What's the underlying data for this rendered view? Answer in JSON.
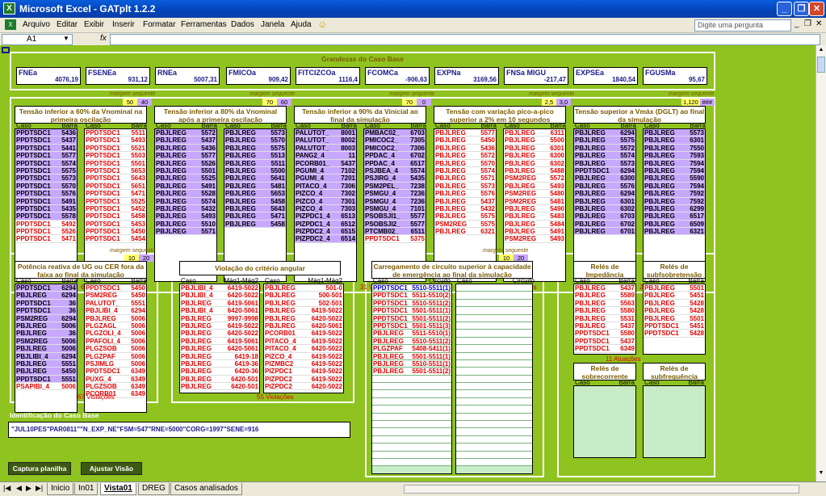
{
  "window": {
    "title": "Microsoft Excel - GATplt 1.2.2"
  },
  "menu": {
    "items": [
      "Arquivo",
      "Editar",
      "Exibir",
      "Inserir",
      "Formatar",
      "Ferramentas",
      "Dados",
      "Janela",
      "Ajuda"
    ],
    "ask_placeholder": "Digite uma pergunta"
  },
  "formula": {
    "namebox": "A1",
    "fx": "fx"
  },
  "grandezas": {
    "title": "Grandezas do Caso Base",
    "items": [
      {
        "label": "FNEa",
        "value": "4076,19"
      },
      {
        "label": "FSENEa",
        "value": "931,12"
      },
      {
        "label": "RNEa",
        "value": "5007,31"
      },
      {
        "label": "FMICOa",
        "value": "909,42"
      },
      {
        "label": "FITCIZCOa",
        "value": "1116,4"
      },
      {
        "label": "FCOMCa",
        "value": "-906,63"
      },
      {
        "label": "EXPNa",
        "value": "3169,56"
      },
      {
        "label": "FNSa MIGU",
        "value": "-217,47"
      },
      {
        "label": "EXPSEa",
        "value": "1840,54"
      },
      {
        "label": "FGUSMa",
        "value": "95,67"
      }
    ]
  },
  "margin_label": "margem sequente",
  "tables_top": [
    {
      "title": "Tensão inferior a 60% da Vnominal na primeira oscilação",
      "n1": "50",
      "n2": "40",
      "viol": "69 Violações",
      "left": [
        [
          "PPDTSDC1",
          "5436",
          "p"
        ],
        [
          "PPDTSDC1",
          "5437",
          "p"
        ],
        [
          "PPDTSDC1",
          "5441",
          "p"
        ],
        [
          "PPDTSDC1",
          "5577",
          "p"
        ],
        [
          "PPDTSDC1",
          "5574",
          "p"
        ],
        [
          "PPDTSDC1",
          "5575",
          "p"
        ],
        [
          "PPDTSDC1",
          "5573",
          "p"
        ],
        [
          "PPDTSDC1",
          "5570",
          "p"
        ],
        [
          "PPDTSDC1",
          "5576",
          "p"
        ],
        [
          "PPDTSDC1",
          "5491",
          "p"
        ],
        [
          "PPDTSDC1",
          "5435",
          "p"
        ],
        [
          "PPDTSDC1",
          "5578",
          "p"
        ],
        [
          "PPDTSDC1",
          "5492",
          "r"
        ],
        [
          "PPDTSDC1",
          "5526",
          "r"
        ],
        [
          "PPDTSDC1",
          "5471",
          "r"
        ]
      ],
      "right": [
        [
          "PPDTSDC1",
          "5511",
          "r"
        ],
        [
          "PPDTSDC1",
          "5493",
          "r"
        ],
        [
          "PPDTSDC1",
          "5521",
          "r"
        ],
        [
          "PPDTSDC1",
          "5503",
          "r"
        ],
        [
          "PPDTSDC1",
          "5501",
          "r"
        ],
        [
          "PPDTSDC1",
          "5653",
          "r"
        ],
        [
          "PPDTSDC1",
          "5643",
          "r"
        ],
        [
          "PPDTSDC1",
          "5651",
          "r"
        ],
        [
          "PPDTSDC1",
          "5471",
          "r"
        ],
        [
          "PPDTSDC1",
          "5525",
          "r"
        ],
        [
          "PPDTSDC1",
          "5452",
          "r"
        ],
        [
          "PPDTSDC1",
          "5458",
          "r"
        ],
        [
          "PPDTSDC1",
          "5453",
          "r"
        ],
        [
          "PPDTSDC1",
          "5450",
          "r"
        ],
        [
          "PPDTSDC1",
          "5454",
          "r"
        ]
      ]
    },
    {
      "title": "Tensão inferior a 80% da Vnominal após a primeira oscilação",
      "n1": "70",
      "n2": "60",
      "viol": "129 Violações",
      "left": [
        [
          "PBJLREG",
          "5572",
          "p"
        ],
        [
          "PBJLREG",
          "5437",
          "p"
        ],
        [
          "PBJLREG",
          "5436",
          "p"
        ],
        [
          "PBJLREG",
          "5577",
          "p"
        ],
        [
          "PBJLREG",
          "5526",
          "p"
        ],
        [
          "PBJLREG",
          "5501",
          "p"
        ],
        [
          "PBJLREG",
          "5525",
          "p"
        ],
        [
          "PBJLREG",
          "5491",
          "p"
        ],
        [
          "PBJLREG",
          "5528",
          "p"
        ],
        [
          "PBJLREG",
          "5574",
          "p"
        ],
        [
          "PBJLREG",
          "5432",
          "p"
        ],
        [
          "PBJLREG",
          "5493",
          "p"
        ],
        [
          "PBJLREG",
          "5510",
          "p"
        ],
        [
          "PBJLREG",
          "5571",
          "p"
        ]
      ],
      "right": [
        [
          "PBJLREG",
          "5573",
          "p"
        ],
        [
          "PBJLREG",
          "5570",
          "p"
        ],
        [
          "PBJLREG",
          "5575",
          "p"
        ],
        [
          "PBJLREG",
          "5513",
          "p"
        ],
        [
          "PBJLREG",
          "5511",
          "p"
        ],
        [
          "PBJLREG",
          "5500",
          "p"
        ],
        [
          "PBJLREG",
          "5641",
          "p"
        ],
        [
          "PBJLREG",
          "5481",
          "p"
        ],
        [
          "PBJLREG",
          "5653",
          "p"
        ],
        [
          "PBJLREG",
          "5458",
          "p"
        ],
        [
          "PBJLREG",
          "5643",
          "p"
        ],
        [
          "PBJLREG",
          "5471",
          "p"
        ],
        [
          "PBJLREG",
          "5458",
          "p"
        ]
      ]
    },
    {
      "title": "Tensão inferior a 90% da Vinicial ao final da simulação",
      "n1": "70",
      "n2": "0",
      "viol": "31 Violações",
      "left": [
        [
          "PALUTOT_",
          "8001",
          "p"
        ],
        [
          "PALUTOT_",
          "8002",
          "p"
        ],
        [
          "PALUTOT_",
          "8003",
          "p"
        ],
        [
          "PANG2_4",
          "11",
          "p"
        ],
        [
          "PCORB01_",
          "5437",
          "p"
        ],
        [
          "PGUMI_4",
          "7102",
          "p"
        ],
        [
          "PGUMI_4",
          "7201",
          "p"
        ],
        [
          "PITACO_4",
          "7306",
          "p"
        ],
        [
          "PIZCO_4",
          "7302",
          "p"
        ],
        [
          "PIZCO_4",
          "7301",
          "p"
        ],
        [
          "PIZCO_4",
          "7303",
          "p"
        ],
        [
          "PIZPDC1_4",
          "6513",
          "p"
        ],
        [
          "PIZPDC1_4",
          "6512",
          "p"
        ],
        [
          "PIZPDC2_4",
          "6515",
          "p"
        ],
        [
          "PIZPDC2_4",
          "6514",
          "p"
        ]
      ],
      "right": [
        [
          "PMBAC02_",
          "6703",
          "p"
        ],
        [
          "PMICOC2_",
          "7305",
          "p"
        ],
        [
          "PMICOC2_",
          "7306",
          "p"
        ],
        [
          "PPDAC_4",
          "6702",
          "p"
        ],
        [
          "PPDAC_4",
          "6517",
          "p"
        ],
        [
          "PSJBEA_4",
          "5574",
          "p"
        ],
        [
          "PSJIRG_4",
          "5435",
          "p"
        ],
        [
          "PSM2PEL_",
          "7238",
          "p"
        ],
        [
          "PSMGU_4",
          "7236",
          "p"
        ],
        [
          "PSMGU_4",
          "7236",
          "p"
        ],
        [
          "PSMGU_4",
          "7101",
          "p"
        ],
        [
          "PSOBSJI1_",
          "5577",
          "p"
        ],
        [
          "PSOBSJI2_",
          "5577",
          "p"
        ],
        [
          "PTCMB02_",
          "6511",
          "p"
        ],
        [
          "PPDTSDC1",
          "5375",
          "r"
        ]
      ]
    },
    {
      "title": "Tensão com variação pico-a-pico superior a 2% em 10 segundos",
      "n1": "2,5",
      "n2": "3,0",
      "viol": "53 Violações",
      "left": [
        [
          "PBJLREG",
          "5577",
          "r"
        ],
        [
          "PBJLREG",
          "5450",
          "r"
        ],
        [
          "PBJLREG",
          "5436",
          "r"
        ],
        [
          "PBJLREG",
          "5572",
          "r"
        ],
        [
          "PBJLREG",
          "5570",
          "r"
        ],
        [
          "PBJLREG",
          "5574",
          "r"
        ],
        [
          "PBJLREG",
          "5571",
          "r"
        ],
        [
          "PBJLREG",
          "5573",
          "r"
        ],
        [
          "PBJLREG",
          "5576",
          "r"
        ],
        [
          "PBJLREG",
          "5437",
          "r"
        ],
        [
          "PBJLREG",
          "5432",
          "r"
        ],
        [
          "PBJLREG",
          "5575",
          "r"
        ],
        [
          "PSM2REG",
          "5575",
          "r"
        ],
        [
          "PBJLREG",
          "6321",
          "r"
        ]
      ],
      "right": [
        [
          "PBJLREG",
          "6311",
          "r"
        ],
        [
          "PBJLREG",
          "5500",
          "r"
        ],
        [
          "PBJLREG",
          "6301",
          "r"
        ],
        [
          "PBJLREG",
          "6300",
          "r"
        ],
        [
          "PBJLREG",
          "6302",
          "r"
        ],
        [
          "PBJLREG",
          "5488",
          "r"
        ],
        [
          "PSM2REG",
          "5572",
          "r"
        ],
        [
          "PBJLREG",
          "5493",
          "r"
        ],
        [
          "PSM2REG",
          "5480",
          "r"
        ],
        [
          "PSM2REG",
          "5481",
          "r"
        ],
        [
          "PBJLREG",
          "5490",
          "r"
        ],
        [
          "PBJLREG",
          "5483",
          "r"
        ],
        [
          "PBJLREG",
          "5484",
          "r"
        ],
        [
          "PBJLREG",
          "5491",
          "r"
        ],
        [
          "PSM2REG",
          "5493",
          "r"
        ]
      ]
    },
    {
      "title": "Tensão superior a Vmáx (DGLT) ao final da simulação",
      "n1": "1,120",
      "n2": "###",
      "viol": "200 Violações",
      "left": [
        [
          "PBJLREG",
          "6294",
          "p"
        ],
        [
          "PBJLREG",
          "5575",
          "p"
        ],
        [
          "PBJLREG",
          "5572",
          "p"
        ],
        [
          "PBJLREG",
          "5574",
          "p"
        ],
        [
          "PBJLREG",
          "5573",
          "p"
        ],
        [
          "PPDTSDC1",
          "6294",
          "p"
        ],
        [
          "PBJLREG",
          "6300",
          "p"
        ],
        [
          "PBJLREG",
          "5576",
          "p"
        ],
        [
          "PBJLREG",
          "6294",
          "p"
        ],
        [
          "PBJLREG",
          "6301",
          "p"
        ],
        [
          "PBJLREG",
          "6302",
          "p"
        ],
        [
          "PBJLREG",
          "6703",
          "p"
        ],
        [
          "PBJLREG",
          "6702",
          "p"
        ],
        [
          "PBJLREG",
          "6701",
          "p"
        ]
      ],
      "right": [
        [
          "PBJLREG",
          "5573",
          "p"
        ],
        [
          "PBJLREG",
          "6301",
          "p"
        ],
        [
          "PBJLREG",
          "7550",
          "p"
        ],
        [
          "PBJLREG",
          "7593",
          "p"
        ],
        [
          "PBJLREG",
          "7594",
          "p"
        ],
        [
          "PBJLREG",
          "7594",
          "p"
        ],
        [
          "PBJLREG",
          "5590",
          "p"
        ],
        [
          "PBJLREG",
          "7594",
          "p"
        ],
        [
          "PBJLREG",
          "7592",
          "p"
        ],
        [
          "PBJLREG",
          "7592",
          "p"
        ],
        [
          "PBJLREG",
          "6299",
          "p"
        ],
        [
          "PBJLREG",
          "6517",
          "p"
        ],
        [
          "PBJLREG",
          "6509",
          "p"
        ],
        [
          "PBJLREG",
          "6321",
          "p"
        ]
      ]
    }
  ],
  "pot": {
    "title": "Potência reativa de UG ou CER fora da faixa ao final da simulação",
    "n1": "10",
    "n2": "20",
    "viol": "67 Violações",
    "left": [
      [
        "PPDTSDC1",
        "6294",
        "p"
      ],
      [
        "PBJLREG",
        "6294",
        "p"
      ],
      [
        "PPDTSDC1",
        "36",
        "p"
      ],
      [
        "PPDTSDC1",
        "36",
        "p"
      ],
      [
        "PSM2REG",
        "6294",
        "p"
      ],
      [
        "PBJLREG",
        "5006",
        "p"
      ],
      [
        "PBJLREG",
        "36",
        "p"
      ],
      [
        "PSM2REG",
        "5006",
        "p"
      ],
      [
        "PBJLREG",
        "5006",
        "p"
      ],
      [
        "PBJLIBI_4",
        "6294",
        "p"
      ],
      [
        "PBJLREG",
        "5551",
        "p"
      ],
      [
        "PBJLREG",
        "5450",
        "p"
      ],
      [
        "PPDTSDC1",
        "5551",
        "p"
      ],
      [
        "PSAPIBI_4",
        "5006",
        "r"
      ]
    ],
    "right": [
      [
        "PPDTSDC1",
        "5450",
        "r"
      ],
      [
        "PSM2REG",
        "5450",
        "r"
      ],
      [
        "PALUTOT_",
        "5551",
        "r"
      ],
      [
        "PBJLIBI_4",
        "6294",
        "r"
      ],
      [
        "PBJLREG",
        "5006",
        "r"
      ],
      [
        "PLGZAGL",
        "5006",
        "r"
      ],
      [
        "PLGZOLI_4",
        "5006",
        "r"
      ],
      [
        "PPAFOLI_4",
        "5006",
        "r"
      ],
      [
        "PLGZSOB",
        "5006",
        "r"
      ],
      [
        "PLGZPAF",
        "5006",
        "r"
      ],
      [
        "PSJIMLG",
        "5006",
        "r"
      ],
      [
        "PPDTSDC1",
        "6349",
        "r"
      ],
      [
        "PUXG_4",
        "6349",
        "r"
      ],
      [
        "PLGZSOB",
        "6349",
        "r"
      ],
      [
        "PCORB01",
        "6349",
        "r"
      ]
    ]
  },
  "ang": {
    "title": "Violação do critério angular",
    "viol": "55 Violações",
    "h1": "Caso",
    "h2": "Máq1-Máq2",
    "left": [
      [
        "PBJLIBI_4",
        "6419-5022"
      ],
      [
        "PBJLIBI_4",
        "6420-5022"
      ],
      [
        "PBJLREG",
        "6419-5061"
      ],
      [
        "PBJLIBI_4",
        "6420-5061"
      ],
      [
        "PBJLREG",
        "9997-9998"
      ],
      [
        "PBJLREG",
        "6419-5022"
      ],
      [
        "PBJLREG",
        "6420-5022"
      ],
      [
        "PBJLREG",
        "6419-5061"
      ],
      [
        "PBJLREG",
        "6420-5061"
      ],
      [
        "PBJLREG",
        "6419-18"
      ],
      [
        "PBJLREG",
        "6419-36"
      ],
      [
        "PBJLREG",
        "6420-36"
      ],
      [
        "PBJLREG",
        "6420-501"
      ],
      [
        "PBJLREG",
        "6420-501"
      ]
    ],
    "right": [
      [
        "PBJLREG",
        "501-0"
      ],
      [
        "PBJLREG",
        "500-501"
      ],
      [
        "PBJLREG",
        "502-501"
      ],
      [
        "PBJLREG",
        "6419-5022"
      ],
      [
        "PBJLREG",
        "6420-5022"
      ],
      [
        "PBJLREG",
        "6420-5061"
      ],
      [
        "PCORB01",
        "6419-5022"
      ],
      [
        "PITACO_4",
        "6419-5022"
      ],
      [
        "PITACO_4",
        "6420-5022"
      ],
      [
        "PIZCO_4",
        "6419-5022"
      ],
      [
        "PIZMBC2",
        "6419-5022"
      ],
      [
        "PIZPDC1",
        "6419-5022"
      ],
      [
        "PIZPDC2",
        "6419-5022"
      ],
      [
        "PIZPDC2",
        "6420-5022"
      ]
    ]
  },
  "carr": {
    "title": "Carregamento de circuito superior à capacidade de emergência ao final da simulação",
    "n1": "10",
    "n2": "20",
    "h1": "Caso",
    "h2": "Circuito",
    "left": [
      [
        "PPDTSDC1",
        "5510-5511(1)",
        "b"
      ],
      [
        "PPDTSDC1",
        "5511-5510(2)",
        "r"
      ],
      [
        "PPDTSDC1",
        "5510-5511(2)",
        "r"
      ],
      [
        "PPDTSDC1",
        "5501-5511(1)",
        "r"
      ],
      [
        "PPDTSDC1",
        "5501-5511(2)",
        "r"
      ],
      [
        "PPDTSDC1",
        "5501-5511(3)",
        "r"
      ],
      [
        "PBJLREG",
        "5511-5510(1)",
        "r"
      ],
      [
        "PBJLREG",
        "5510-5511(2)",
        "r"
      ],
      [
        "PLGZPAF",
        "5408-5411(1)",
        "r"
      ],
      [
        "PBJLREG",
        "5501-5511(1)",
        "r"
      ],
      [
        "PBJLREG",
        "5510-5511(1)",
        "r"
      ],
      [
        "PBJLREG",
        "5501-5511(2)",
        "r"
      ]
    ]
  },
  "reles": {
    "imp": {
      "title": "Relés de Impedância",
      "viol": "11 Atuações",
      "left": [
        [
          "PBJLREG",
          "5437",
          "r"
        ],
        [
          "PBJLREG",
          "5589",
          "r"
        ],
        [
          "PBJLREG",
          "5563",
          "r"
        ],
        [
          "PBJLREG",
          "5580",
          "r"
        ],
        [
          "PBJLREG",
          "5531",
          "r"
        ],
        [
          "PBJLREG",
          "5437",
          "r"
        ],
        [
          "PPDTSDC1",
          "5580",
          "r"
        ],
        [
          "PPDTSDC1",
          "5437",
          "r"
        ],
        [
          "PPDTSDC1",
          "6349",
          "r"
        ]
      ],
      "right": [
        [
          "PBJLREG",
          "5501",
          "r"
        ],
        [
          "PBJLREG",
          "5451",
          "r"
        ],
        [
          "PBJLREG",
          "5428",
          "r"
        ],
        [
          "PBJLREG",
          "5428",
          "r"
        ],
        [
          "PBJLREG",
          "5501",
          "r"
        ],
        [
          "PPDTSDC1",
          "5451",
          "r"
        ],
        [
          "PPDTSDC1",
          "5428",
          "r"
        ]
      ]
    },
    "sobrec": {
      "title": "Relés de sobrecorrente"
    },
    "subfreq": {
      "title": "Relés de subfrequência"
    },
    "sobret": {
      "title": "Relés de subfsobretensão"
    }
  },
  "labels": {
    "caso": "Caso",
    "barra": "Barra",
    "circuito": "Circuito"
  },
  "ident": {
    "label": "Identificação do Caso Base",
    "value": "\"JUL10PES\"PAR0811\"\"N_EXP_NE\"FSM=547\"RNE=5000\"CORG=1997\"SENE=916"
  },
  "buttons": {
    "captura": "Captura planilha",
    "ajustar": "Ajustar Visão"
  },
  "tabs": [
    "Inicio",
    "In01",
    "Vista01",
    "DREG",
    "Casos analisados"
  ],
  "active_tab": "Vista01"
}
